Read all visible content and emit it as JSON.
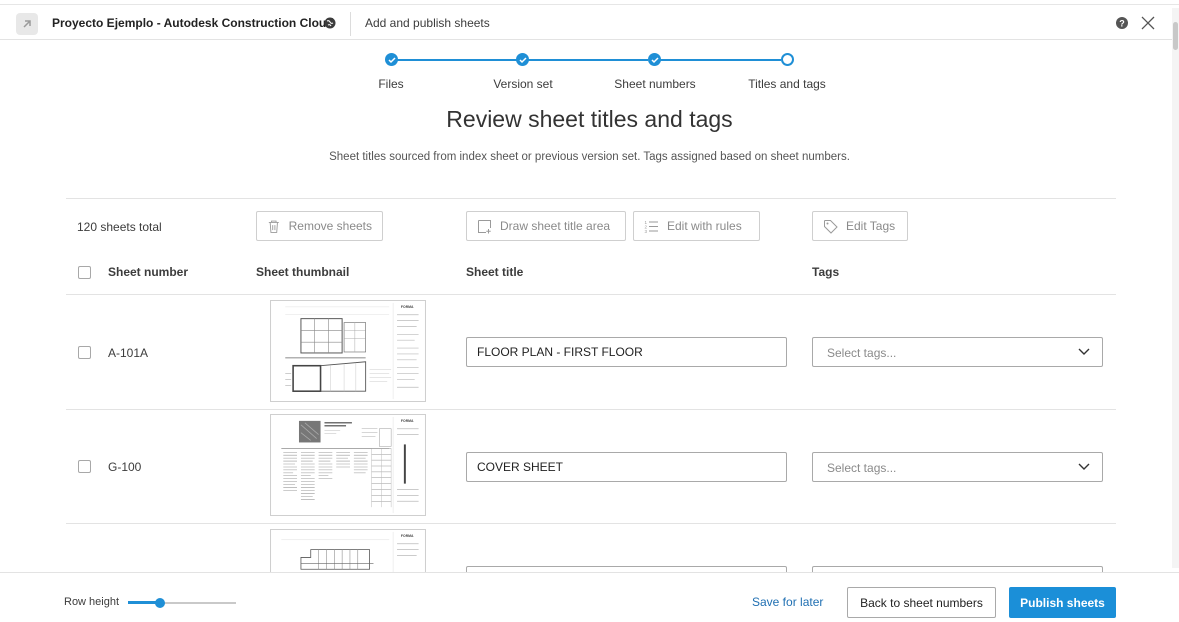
{
  "header": {
    "project_name": "Proyecto Ejemplo - Autodesk Construction Cloud",
    "dialog_title": "Add and publish sheets"
  },
  "stepper": {
    "steps": [
      {
        "label": "Files",
        "status": "complete"
      },
      {
        "label": "Version set",
        "status": "complete"
      },
      {
        "label": "Sheet numbers",
        "status": "complete"
      },
      {
        "label": "Titles and tags",
        "status": "current"
      }
    ]
  },
  "main": {
    "title": "Review sheet titles and tags",
    "subtitle": "Sheet titles sourced from index sheet or previous version set. Tags assigned based on sheet numbers."
  },
  "toolbar": {
    "total": "120 sheets total",
    "remove_label": "Remove sheets",
    "draw_label": "Draw sheet title area",
    "rules_label": "Edit with rules",
    "tags_label": "Edit Tags"
  },
  "table": {
    "columns": {
      "number": "Sheet number",
      "thumbnail": "Sheet thumbnail",
      "title": "Sheet title",
      "tags": "Tags"
    },
    "rows": [
      {
        "number": "A-101A",
        "title": "FLOOR PLAN - FIRST FLOOR",
        "tags_placeholder": "Select tags..."
      },
      {
        "number": "G-100",
        "title": "COVER SHEET",
        "tags_placeholder": "Select tags..."
      },
      {
        "number": "",
        "title": "",
        "tags_placeholder": ""
      }
    ]
  },
  "footer": {
    "row_height_label": "Row height",
    "row_height_value": 0.3,
    "save_label": "Save for later",
    "back_label": "Back to sheet numbers",
    "publish_label": "Publish sheets"
  },
  "colors": {
    "accent": "#1f8fd6",
    "primary_button": "#1b8fd8",
    "link": "#1f6fb2"
  }
}
